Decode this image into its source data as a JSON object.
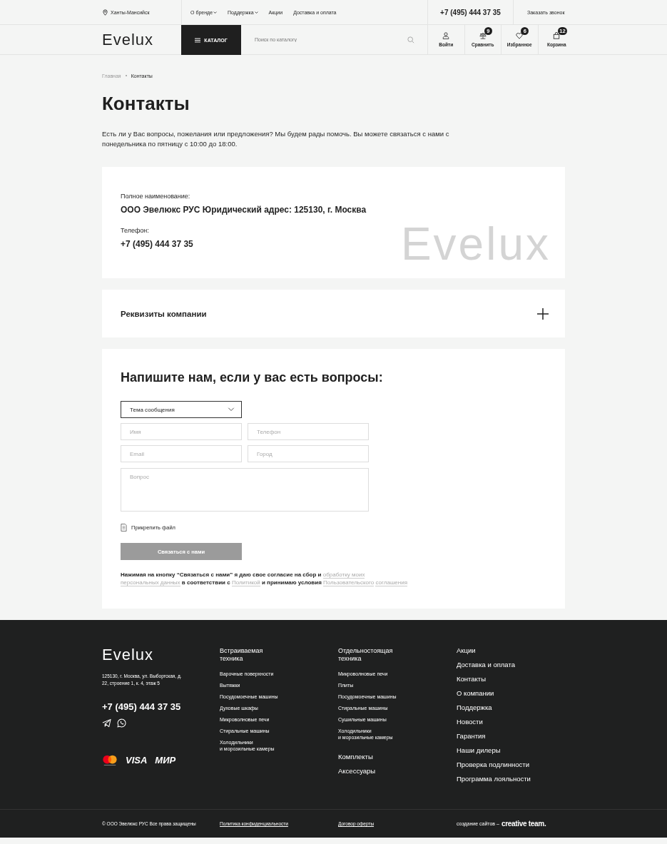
{
  "header": {
    "city": "Ханты-Мансийск",
    "nav": [
      {
        "label": "О бренде",
        "dropdown": true
      },
      {
        "label": "Поддержка",
        "dropdown": true
      },
      {
        "label": "Акции",
        "dropdown": false
      },
      {
        "label": "Доставка и оплата",
        "dropdown": false
      }
    ],
    "phone": "+7 (495) 444 37 35",
    "callback": "Заказать звонок",
    "logo": "Evelux",
    "catalog": "КАТАЛОГ",
    "search": {
      "placeholder": "Поиск по каталогу"
    },
    "actions": [
      {
        "kind": "user",
        "label": "Войти"
      },
      {
        "kind": "compare",
        "label": "Сравнить",
        "badge": "9"
      },
      {
        "kind": "favorite",
        "label": "Избранное",
        "badge": "6"
      },
      {
        "kind": "cart",
        "label": "Корзина",
        "badge": "12"
      }
    ]
  },
  "breadcrumbs": [
    {
      "label": "Главная",
      "current": false
    },
    {
      "label": "Контакты",
      "current": true
    }
  ],
  "title": "Контакты",
  "intro": "Есть ли у Вас вопросы, пожелания или предложения? Мы будем рады помочь. Вы можете связаться с нами с понедельника по пятницу с 10:00 до 18:00.",
  "company": {
    "fields": [
      {
        "label": "Полное наименование:",
        "value": "ООО Эвелюкс РУС Юридический адрес: 125130, г. Москва"
      },
      {
        "label": "Телефон:",
        "value": "+7 (495) 444 37 35"
      }
    ],
    "watermark": "Evelux"
  },
  "accordion": {
    "title": "Реквизиты компании",
    "expanded": false
  },
  "form": {
    "title": "Напишите нам, если у вас есть вопросы:",
    "topic": "Тема сообщения",
    "fields": [
      {
        "placeholder": "Имя"
      },
      {
        "placeholder": "Телефон"
      },
      {
        "placeholder": "Email"
      },
      {
        "placeholder": "Город"
      }
    ],
    "question": {
      "placeholder": "Вопрос"
    },
    "attach": "Прикрепить файл",
    "submit": {
      "label": "Связаться с нами",
      "disabled": true
    },
    "consent": [
      {
        "kind": "text",
        "text": "Нажимая на кнопку “Связаться с нами” я даю свое согласие на сбор и"
      },
      {
        "kind": "link",
        "text": "обработку моих"
      },
      {
        "kind": "link",
        "text": "персональных данных"
      },
      {
        "kind": "text",
        "text": "в соответствии с"
      },
      {
        "kind": "link",
        "text": "Политикой"
      },
      {
        "kind": "text",
        "text": "и принимаю условия"
      },
      {
        "kind": "link",
        "text": "Пользовательского"
      },
      {
        "kind": "link",
        "text": "соглашения"
      }
    ]
  },
  "footer": {
    "logo": "Evelux",
    "address": "125130, г. Москва, ул. Выборгская, д. 22, строение 1, к. 4, этаж 5",
    "phone": "+7 (495) 444 37 35",
    "payments": [
      "VISA",
      "МИР"
    ],
    "columns": [
      {
        "title": "Встраиваемая техника",
        "links": [
          "Варочные поверхности",
          "Вытяжки",
          "Посудомоечные машины",
          "Духовые шкафы",
          "Микроволновые печи",
          "Стиральные машины",
          "Холодильники\nи морозильные камеры"
        ]
      },
      {
        "title": "Отдельностоящая техника",
        "links": [
          "Микроволновые печи",
          "Плиты",
          "Посудомоечные машины",
          "Стиральные машины",
          "Сушильные машины",
          "Холодильники\nи морозильные камеры"
        ],
        "extra": [
          "Комплекты",
          "Аксессуары"
        ]
      }
    ],
    "menu": [
      "Акции",
      "Доставка и оплата",
      "Контакты",
      "О компании",
      "Поддержка",
      "Новости",
      "Гарантия",
      "Наши дилеры",
      "Проверка подлинности",
      "Программа лояльности"
    ],
    "copyright": "© ООО Эвелюкс РУС Все права защищены",
    "links": [
      "Политика конфиденциальности",
      "Договор оферты"
    ],
    "credit": "создание сайтов –",
    "credit_logo": "creative team."
  }
}
